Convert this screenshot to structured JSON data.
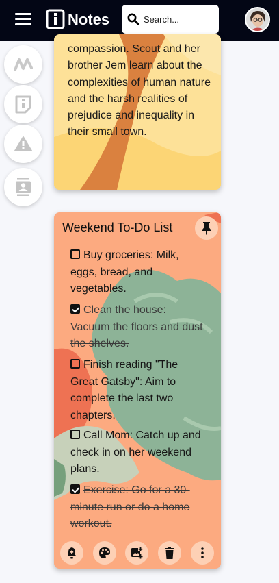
{
  "header": {
    "app_title": "Notes",
    "search_placeholder": "Search...",
    "bg_color": "#030615"
  },
  "side_rail": {
    "items": [
      {
        "icon": "brand-icon"
      },
      {
        "icon": "notes-icon"
      },
      {
        "icon": "warning-icon"
      },
      {
        "icon": "contact-icon"
      }
    ]
  },
  "notes": [
    {
      "color": "#fde198",
      "text": "compassion. Scout and her brother Jem learn about the complexities of human nature and the harsh realities of prejudice and inequality in their small town."
    },
    {
      "color": "#fcaa80",
      "title": "Weekend To-Do List",
      "items": [
        {
          "text": "Buy groceries: Milk, eggs, bread, and vegetables.",
          "done": false
        },
        {
          "text": "Clean the house: Vacuum the floors and dust the shelves.",
          "done": true
        },
        {
          "text": "Finish reading \"The Great Gatsby\": Aim to complete the last two chapters.",
          "done": false
        },
        {
          "text": "Call Mom: Catch up and check in on her weekend plans.",
          "done": false
        },
        {
          "text": "Exercise: Go for a 30-minute run or do a home workout.",
          "done": true
        }
      ],
      "actions": [
        "reminder-icon",
        "palette-icon",
        "add-image-icon",
        "delete-icon",
        "more-icon"
      ]
    }
  ]
}
